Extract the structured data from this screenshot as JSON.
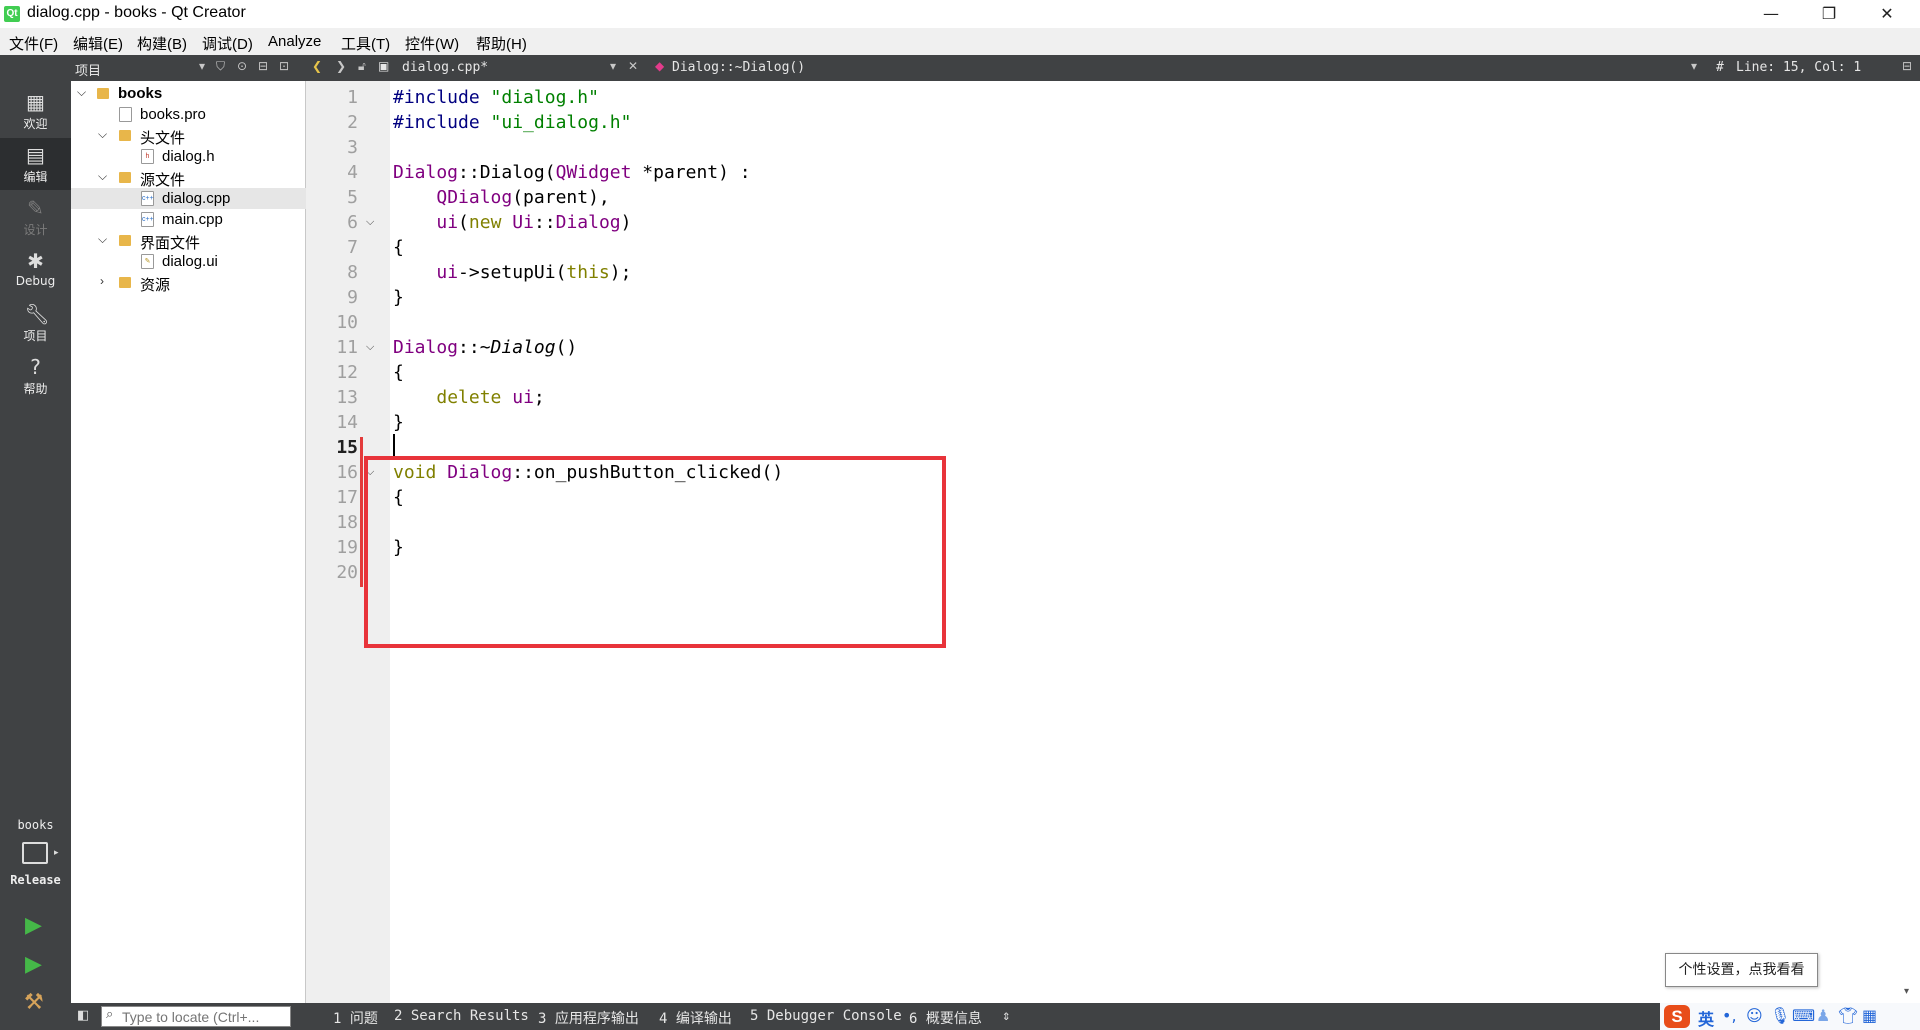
{
  "window": {
    "title": "dialog.cpp - books - Qt Creator",
    "app_icon_label": "Qt",
    "minimize": "—",
    "maximize": "❐",
    "close": "✕"
  },
  "menu": [
    "文件(F)",
    "编辑(E)",
    "构建(B)",
    "调试(D)",
    "Analyze",
    "工具(T)",
    "控件(W)",
    "帮助(H)"
  ],
  "project_panel": {
    "selector_label": "项目",
    "tree": [
      {
        "label": "books",
        "bold": true,
        "expanded": true,
        "type": "project"
      },
      {
        "label": "books.pro",
        "type": "file"
      },
      {
        "label": "头文件",
        "expanded": true,
        "type": "folder"
      },
      {
        "label": "dialog.h",
        "type": "header"
      },
      {
        "label": "源文件",
        "expanded": true,
        "type": "folder"
      },
      {
        "label": "dialog.cpp",
        "type": "source",
        "selected": true
      },
      {
        "label": "main.cpp",
        "type": "source"
      },
      {
        "label": "界面文件",
        "expanded": true,
        "type": "folder"
      },
      {
        "label": "dialog.ui",
        "type": "ui"
      },
      {
        "label": "资源",
        "expanded": false,
        "type": "folder"
      }
    ]
  },
  "modes": [
    {
      "label": "欢迎",
      "icon": "grid-icon"
    },
    {
      "label": "编辑",
      "icon": "edit-icon",
      "active": true
    },
    {
      "label": "设计",
      "icon": "pencil-icon",
      "disabled": true
    },
    {
      "label": "Debug",
      "icon": "bug-icon"
    },
    {
      "label": "项目",
      "icon": "wrench-icon"
    },
    {
      "label": "帮助",
      "icon": "help-icon"
    }
  ],
  "kit": {
    "project": "books",
    "build": "Release"
  },
  "editor_toolbar": {
    "file_name": "dialog.cpp*",
    "symbol": "Dialog::~Dialog()",
    "position": "Line: 15, Col: 1",
    "hash": "#"
  },
  "editor": {
    "line_numbers": [
      "1",
      "2",
      "3",
      "4",
      "5",
      "6",
      "7",
      "8",
      "9",
      "10",
      "11",
      "12",
      "13",
      "14",
      "15",
      "16",
      "17",
      "18",
      "19",
      "20"
    ],
    "current_line": 15
  },
  "bottom": {
    "locator_placeholder": "Type to locate (Ctrl+...",
    "tabs": [
      "1 问题",
      "2 Search Results",
      "3 应用程序输出",
      "4 编译输出",
      "5 Debugger Console",
      "6 概要信息"
    ]
  },
  "tooltip": "个性设置，点我看看",
  "ime": {
    "logo": "S",
    "mode": "英",
    "punct": "•,"
  }
}
